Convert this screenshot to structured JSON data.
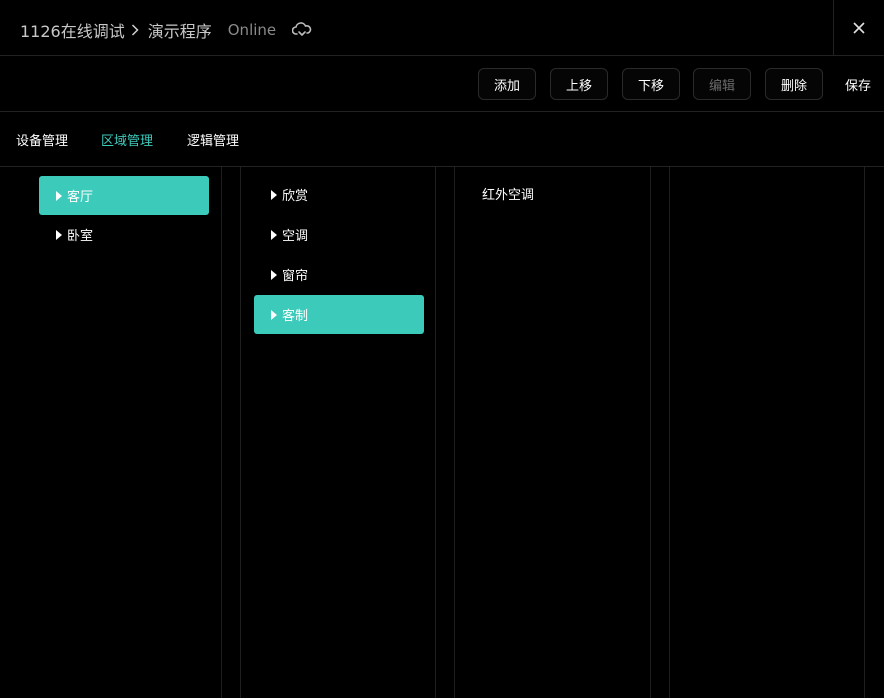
{
  "header": {
    "project": "1126在线调试",
    "page": "演示程序",
    "status": "Online",
    "cloud_icon": "cloud-sync-icon",
    "close_icon": "close-icon"
  },
  "toolbar": {
    "add": "添加",
    "move_up": "上移",
    "move_down": "下移",
    "edit": "编辑",
    "delete": "删除",
    "save": "保存"
  },
  "tabs": {
    "devices": "设备管理",
    "areas": "区域管理",
    "logic": "逻辑管理",
    "active": "区域管理",
    "accent_color": "#3ccabb"
  },
  "rooms": [
    {
      "label": "客厅",
      "selected": true
    },
    {
      "label": "卧室",
      "selected": false
    }
  ],
  "groups": [
    {
      "label": "欣赏",
      "selected": false
    },
    {
      "label": "空调",
      "selected": false
    },
    {
      "label": "窗帘",
      "selected": false
    },
    {
      "label": "客制",
      "selected": true
    }
  ],
  "devices": [
    {
      "label": "红外空调"
    }
  ]
}
